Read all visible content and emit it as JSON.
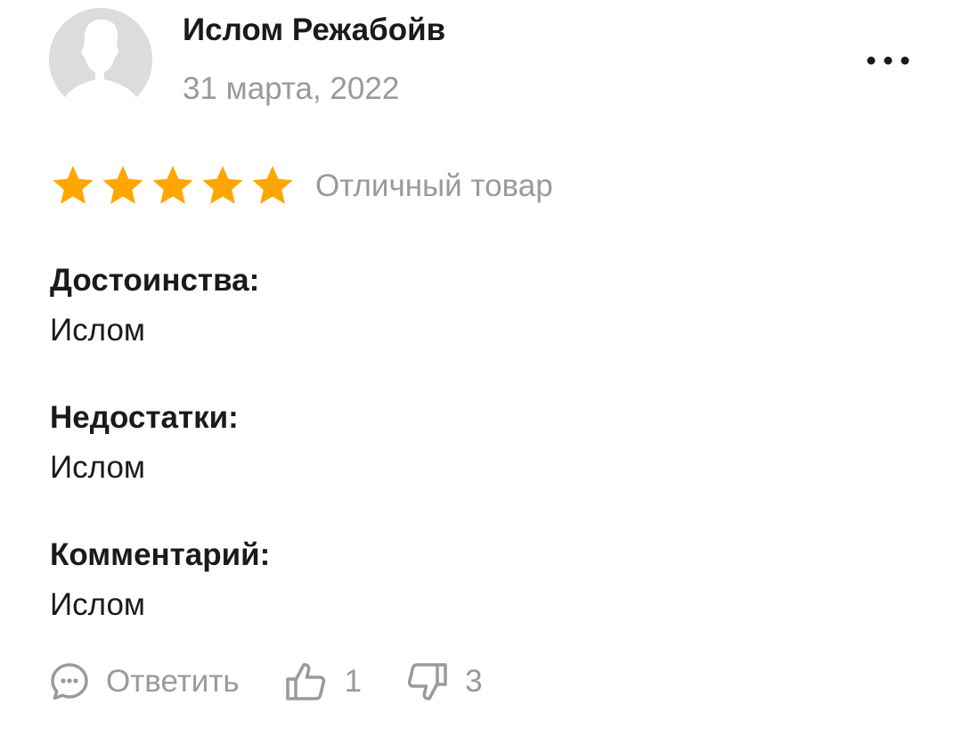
{
  "review": {
    "author": "Ислом Режабойв",
    "date": "31 марта, 2022",
    "rating": {
      "value": 5,
      "max": 5,
      "label": "Отличный товар",
      "star_color": "#FFA600"
    },
    "sections": [
      {
        "title": "Достоинства:",
        "text": "Ислом"
      },
      {
        "title": "Недостатки:",
        "text": "Ислом"
      },
      {
        "title": "Комментарий:",
        "text": "Ислом"
      }
    ],
    "actions": {
      "reply_label": "Ответить",
      "likes": "1",
      "dislikes": "3"
    },
    "icons": {
      "avatar": "avatar-placeholder-icon",
      "more": "more-dots-icon",
      "reply": "comment-icon",
      "like": "thumbs-up-icon",
      "dislike": "thumbs-down-icon"
    }
  }
}
